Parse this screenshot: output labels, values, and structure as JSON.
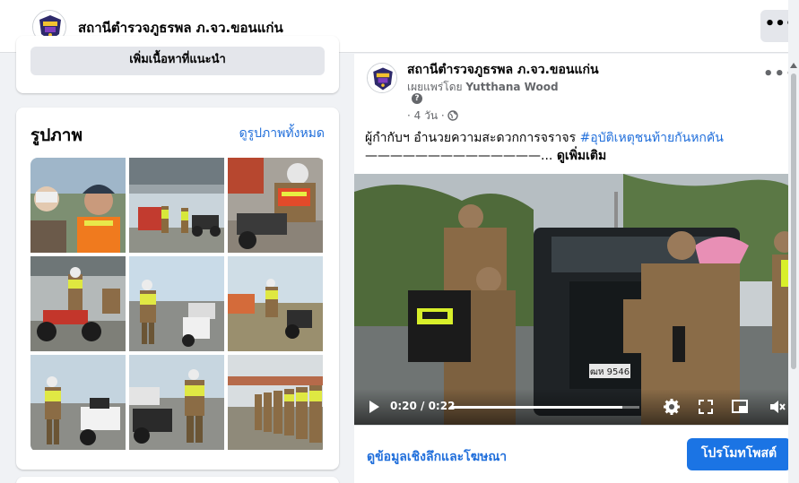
{
  "header": {
    "page_name": "สถานีตำรวจภูธรพล ภ.จว.ขอนแก่น",
    "more_label": "•••"
  },
  "suggest": {
    "button_label": "เพิ่มเนื้อหาที่แนะนำ"
  },
  "photos": {
    "title": "รูปภาพ",
    "see_all": "ดูรูปภาพทั้งหมด",
    "tiles": [
      "police-selfie-photo",
      "officers-under-overpass-photo",
      "officer-kneeling-motorcycle-photo",
      "officer-red-motorcycle-photo",
      "officer-standing-road-photo",
      "officer-motorcycle-roadside-photo",
      "officer-police-motorcycle-photo",
      "officer-scooter-street-photo",
      "officers-lineup-photo"
    ]
  },
  "post": {
    "author": "สถานีตำรวจภูธรพล ภ.จว.ขอนแก่น",
    "published_by_prefix": "เผยแพร่โดย",
    "published_by_name": "Yutthana Wood",
    "help_badge": "?",
    "time": "· 4 วัน ·",
    "more_label": "•••",
    "text_plain": "ผู้กำกับฯ อำนวยความสะดวกการจราจร",
    "text_hashtag": "#อุบัติเหตุชนท้ายกันหกคัน",
    "text_line2": "——————————————...",
    "see_more": "ดูเพิ่มเติม",
    "video": {
      "time_display": "0:20 / 0:22",
      "progress": 0.91,
      "plate_text": "ฒห 9546"
    },
    "insights_label": "ดูข้อมูลเชิงลึกและโฆษณา",
    "promote_label": "โปรโมทโพสต์"
  },
  "colors": {
    "link": "#216fdb",
    "primary_button": "#1b74e4",
    "page_bg": "#f0f2f5",
    "secondary_button": "#e4e6eb"
  }
}
